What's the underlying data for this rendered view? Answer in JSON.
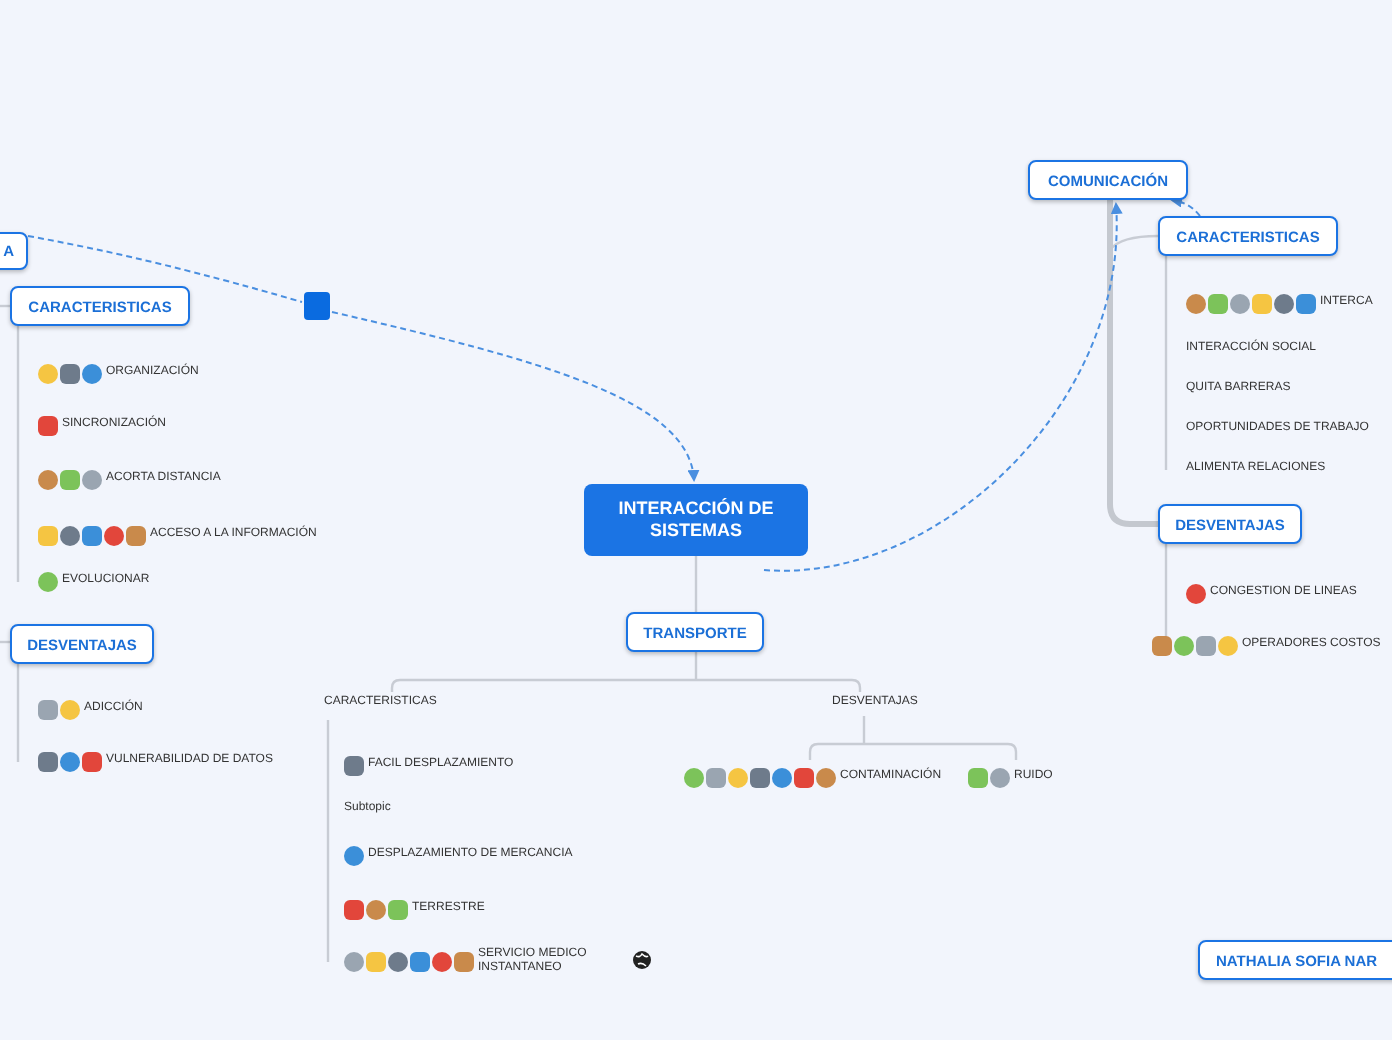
{
  "central_topic": {
    "title": "INTERACCIÓN DE SISTEMAS"
  },
  "main_topics": [
    {
      "title": "A",
      "subtopics": [
        {
          "kind": "boxed",
          "title": "CARACTERISTICAS",
          "items": [
            "ORGANIZACIÓN",
            "SINCRONIZACIÓN",
            "ACORTA DISTANCIA",
            "ACCESO A LA INFORMACIÓN",
            "EVOLUCIONAR"
          ]
        },
        {
          "kind": "boxed",
          "title": "DESVENTAJAS",
          "items": [
            "ADICCIÓN",
            "VULNERABILIDAD DE DATOS"
          ]
        }
      ]
    },
    {
      "title": "COMUNICACIÓN",
      "subtopics": [
        {
          "kind": "boxed",
          "title": "CARACTERISTICAS",
          "items": [
            "INTERCA",
            "INTERACCIÓN SOCIAL",
            "QUITA BARRERAS",
            "OPORTUNIDADES DE TRABAJO",
            "ALIMENTA RELACIONES"
          ]
        },
        {
          "kind": "boxed",
          "title": "DESVENTAJAS",
          "items": [
            "CONGESTION DE LINEAS",
            "OPERADORES COSTOS"
          ]
        }
      ]
    },
    {
      "title": "TRANSPORTE",
      "subtopics": [
        {
          "kind": "plain",
          "title": "CARACTERISTICAS",
          "items": [
            "FACIL DESPLAZAMIENTO",
            "Subtopic",
            "DESPLAZAMIENTO DE MERCANCIA",
            "TERRESTRE",
            "SERVICIO MEDICO INSTANTANEO"
          ]
        },
        {
          "kind": "plain",
          "title": "DESVENTAJAS",
          "items": [
            "CONTAMINACIÓN",
            "RUIDO"
          ]
        }
      ]
    }
  ],
  "floating_topics": [
    {
      "title": "NATHALIA SOFIA NAR"
    }
  ]
}
